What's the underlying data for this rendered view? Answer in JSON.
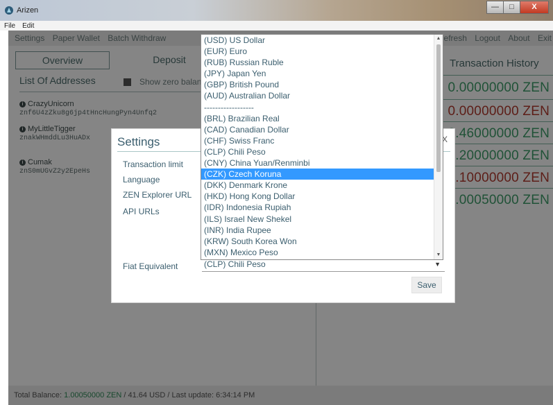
{
  "window": {
    "title": "Arizen",
    "buttons": {
      "minimize": "—",
      "maximize": "□",
      "close": "X"
    }
  },
  "menubar": {
    "items": [
      "File",
      "Edit"
    ]
  },
  "nav": {
    "left": [
      "Settings",
      "Paper Wallet",
      "Batch Withdraw"
    ],
    "right": [
      "Refresh",
      "Logout",
      "About",
      "Exit"
    ]
  },
  "tabs": {
    "overview": "Overview",
    "deposit": "Deposit"
  },
  "addresses": {
    "title": "List Of Addresses",
    "show_zero_label": "Show zero balances",
    "items": [
      {
        "name": "CrazyUnicorn",
        "hash": "znf6U4zZku8g6jp4tHncHungPyn4Unfq2"
      },
      {
        "name": "MyLittleTigger",
        "hash": "znakWHmddLu3HuADx"
      },
      {
        "name": "Cumak",
        "hash": "znS0mUGvZ2y2EpeHs"
      }
    ]
  },
  "history": {
    "title": "Transaction History",
    "amounts": [
      {
        "text": "0.00000000 ZEN",
        "color": "#3f9e6a"
      },
      {
        "text": "0.00000000 ZEN",
        "color": "#b23a2e"
      },
      {
        "text": "0.46000000 ZEN",
        "color": "#3f9e6a"
      },
      {
        "text": "0.20000000 ZEN",
        "color": "#3f9e6a"
      },
      {
        "text": "0.10000000 ZEN",
        "color": "#b23a2e"
      },
      {
        "text": "1.00050000 ZEN",
        "color": "#3f9e6a"
      }
    ]
  },
  "status": {
    "prefix": "Total Balance: ",
    "balance": "1.00050000 ZEN",
    "suffix": " / 41.64 USD / Last update: 6:34:14 PM"
  },
  "settings_dialog": {
    "title": "Settings",
    "close": "X",
    "labels": [
      "Transaction limit",
      "Language",
      "ZEN Explorer URL",
      "API URLs"
    ],
    "fiat_label": "Fiat Equivalent",
    "fiat_value": "(CLP) Chili Peso",
    "save": "Save"
  },
  "currency_options": {
    "selected_index": 12,
    "items": [
      "(USD) US Dollar",
      "(EUR) Euro",
      "(RUB) Russian Ruble",
      "(JPY) Japan Yen",
      "(GBP) British Pound",
      "(AUD) Australian Dollar",
      "------------------",
      "(BRL) Brazilian Real",
      "(CAD) Canadian Dollar",
      "(CHF) Swiss Franc",
      "(CLP) Chili Peso",
      "(CNY) China Yuan/Renminbi",
      "(CZK) Czech Koruna",
      "(DKK) Denmark Krone",
      "(HKD) Hong Kong Dollar",
      "(IDR) Indonesia Rupiah",
      "(ILS) Israel New Shekel",
      "(INR) India Rupee",
      "(KRW) South Korea Won",
      "(MXN) Mexico Peso"
    ]
  }
}
